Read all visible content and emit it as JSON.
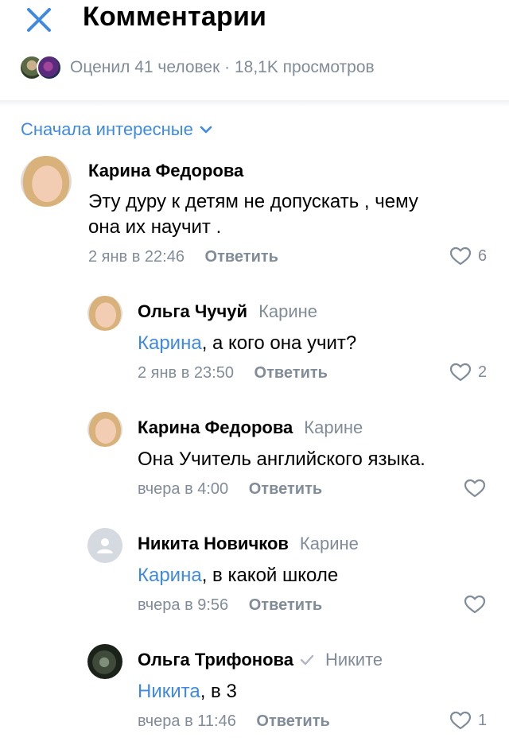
{
  "header": {
    "title": "Комментарии"
  },
  "stats": {
    "text": "Оценил 41 человек · 18,1K просмотров"
  },
  "sort": {
    "label": "Сначала интересные"
  },
  "comments": [
    {
      "author": "Карина Федорова",
      "text": "Эту дуру к детям не допускать , чему",
      "text2": "она их научит .",
      "time": "2 янв в 22:46",
      "reply_label": "Ответить",
      "likes": "6"
    },
    {
      "author": "Ольга Чучуй",
      "reply_to": "Карине",
      "mention": "Карина",
      "text": ", а кого она учит?",
      "time": "2 янв в 23:50",
      "reply_label": "Ответить",
      "likes": "2"
    },
    {
      "author": "Карина Федорова",
      "reply_to": "Карине",
      "text": "Она Учитель английского языка.",
      "time": "вчера в 4:00",
      "reply_label": "Ответить"
    },
    {
      "author": "Никита Новичков",
      "reply_to": "Карине",
      "mention": "Карина",
      "text": ", в какой школе",
      "time": "вчера в 9:56",
      "reply_label": "Ответить"
    },
    {
      "author": "Ольга Трифонова",
      "reply_to": "Никите",
      "mention": "Никита",
      "text": ", в 3",
      "time": "вчера в 11:46",
      "reply_label": "Ответить",
      "likes": "1"
    }
  ],
  "colors": {
    "accent": "#3f8ae0",
    "secondary_text": "#818c99"
  }
}
